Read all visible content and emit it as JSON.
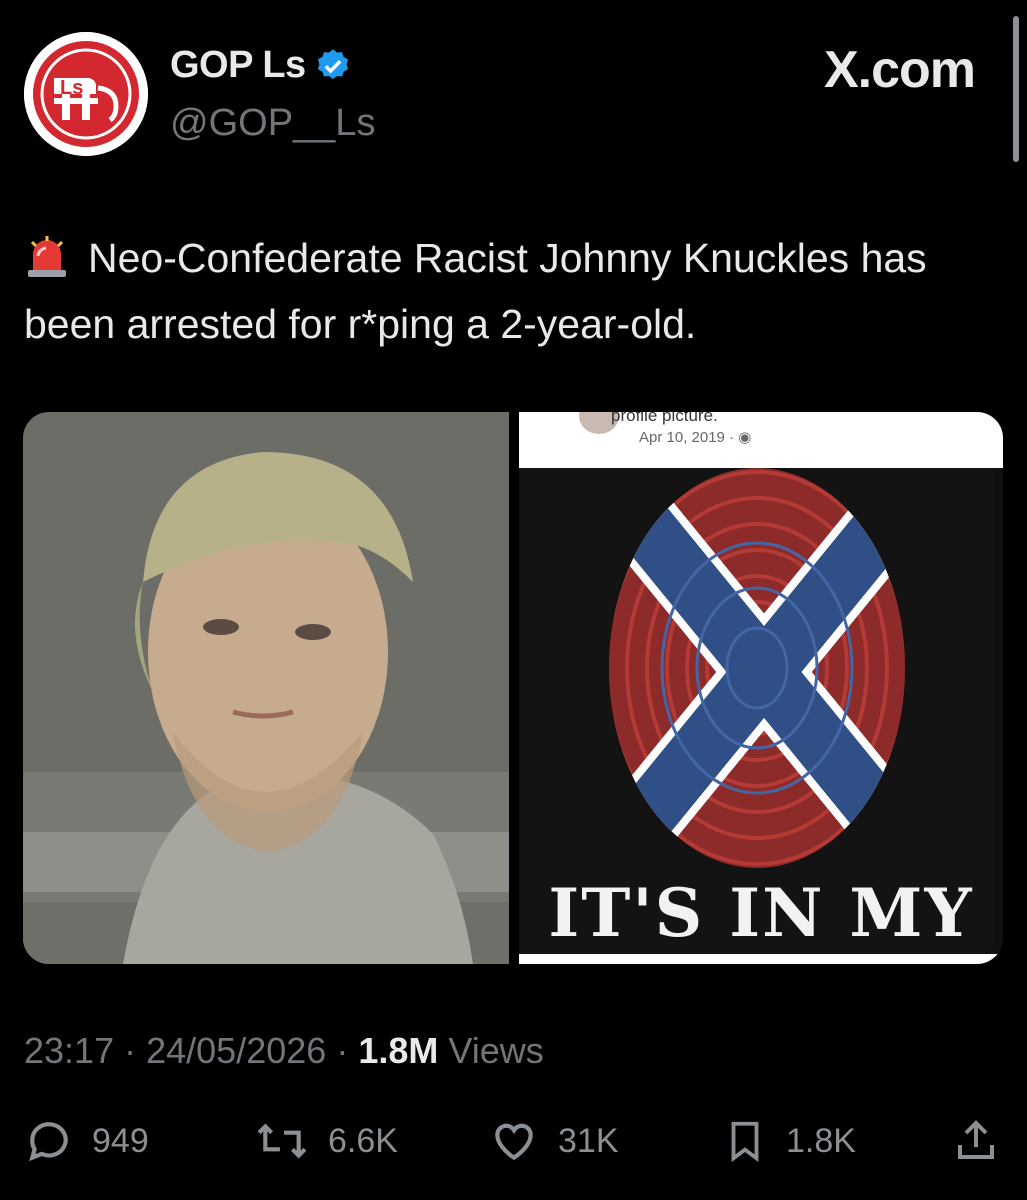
{
  "account": {
    "display_name": "GOP Ls",
    "handle": "@GOP__Ls",
    "avatar_text": "Ls",
    "verified_icon": "verified-badge-icon",
    "brand_color": "#d3282f"
  },
  "site_label": "X.com",
  "tweet": {
    "emoji_icon": "police-siren-icon",
    "text": "Neo-Confederate Racist Johnny Knuckles has been arrested for r*ping a 2-year-old."
  },
  "media": {
    "right_image": {
      "header_text": "profile picture.",
      "date": "Apr 10, 2019 ·",
      "caption": "IT'S IN MY"
    }
  },
  "meta": {
    "time": "23:17",
    "date": "24/05/2026",
    "views_count": "1.8M",
    "views_label": "Views"
  },
  "actions": {
    "replies": "949",
    "reposts": "6.6K",
    "likes": "31K",
    "bookmarks": "1.8K"
  }
}
